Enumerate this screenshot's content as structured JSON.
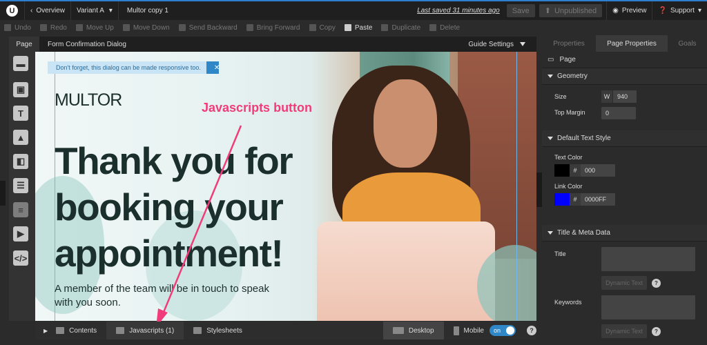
{
  "topbar": {
    "overview": "Overview",
    "variant": "Variant A",
    "page_name": "Multor copy 1",
    "last_saved": "Last saved 31 minutes ago",
    "save": "Save",
    "unpublished": "Unpublished",
    "preview": "Preview",
    "support": "Support"
  },
  "toolbar": [
    "Undo",
    "Redo",
    "Move Up",
    "Move Down",
    "Send Backward",
    "Bring Forward",
    "Copy",
    "Paste",
    "Duplicate",
    "Delete"
  ],
  "editor": {
    "page_tab": "Page",
    "title": "Form Confirmation Dialog",
    "guide_settings": "Guide Settings"
  },
  "canvas": {
    "tip": "Don't forget, this dialog can be made responsive too.",
    "tip_close": "✕",
    "brand": "MULTOR",
    "headline": "Thank you for booking your appointment!",
    "subtext": "A member of the team will be in touch to speak with you soon.",
    "annotation": "Javascripts button"
  },
  "bottom": {
    "contents": "Contents",
    "javascripts": "Javascripts (1)",
    "stylesheets": "Stylesheets",
    "desktop": "Desktop",
    "mobile": "Mobile",
    "toggle": "on",
    "help": "?"
  },
  "panel": {
    "tabs": [
      "Properties",
      "Page Properties",
      "Goals"
    ],
    "page_label": "Page",
    "geometry": "Geometry",
    "size_label": "Size",
    "w_label": "W",
    "width": "940",
    "top_margin_label": "Top Margin",
    "top_margin": "0",
    "default_text_style": "Default Text Style",
    "text_color_label": "Text Color",
    "text_color": "000",
    "link_color_label": "Link Color",
    "link_color": "0000FF",
    "title_meta": "Title & Meta Data",
    "title_label": "Title",
    "keywords_label": "Keywords",
    "dynamic_text": "Dynamic Text",
    "hash": "#",
    "help": "?"
  },
  "colors": {
    "accent": "#2f87c8",
    "annotation": "#f03c78",
    "text_color_swatch": "#000000",
    "link_color_swatch": "#0000FF"
  }
}
